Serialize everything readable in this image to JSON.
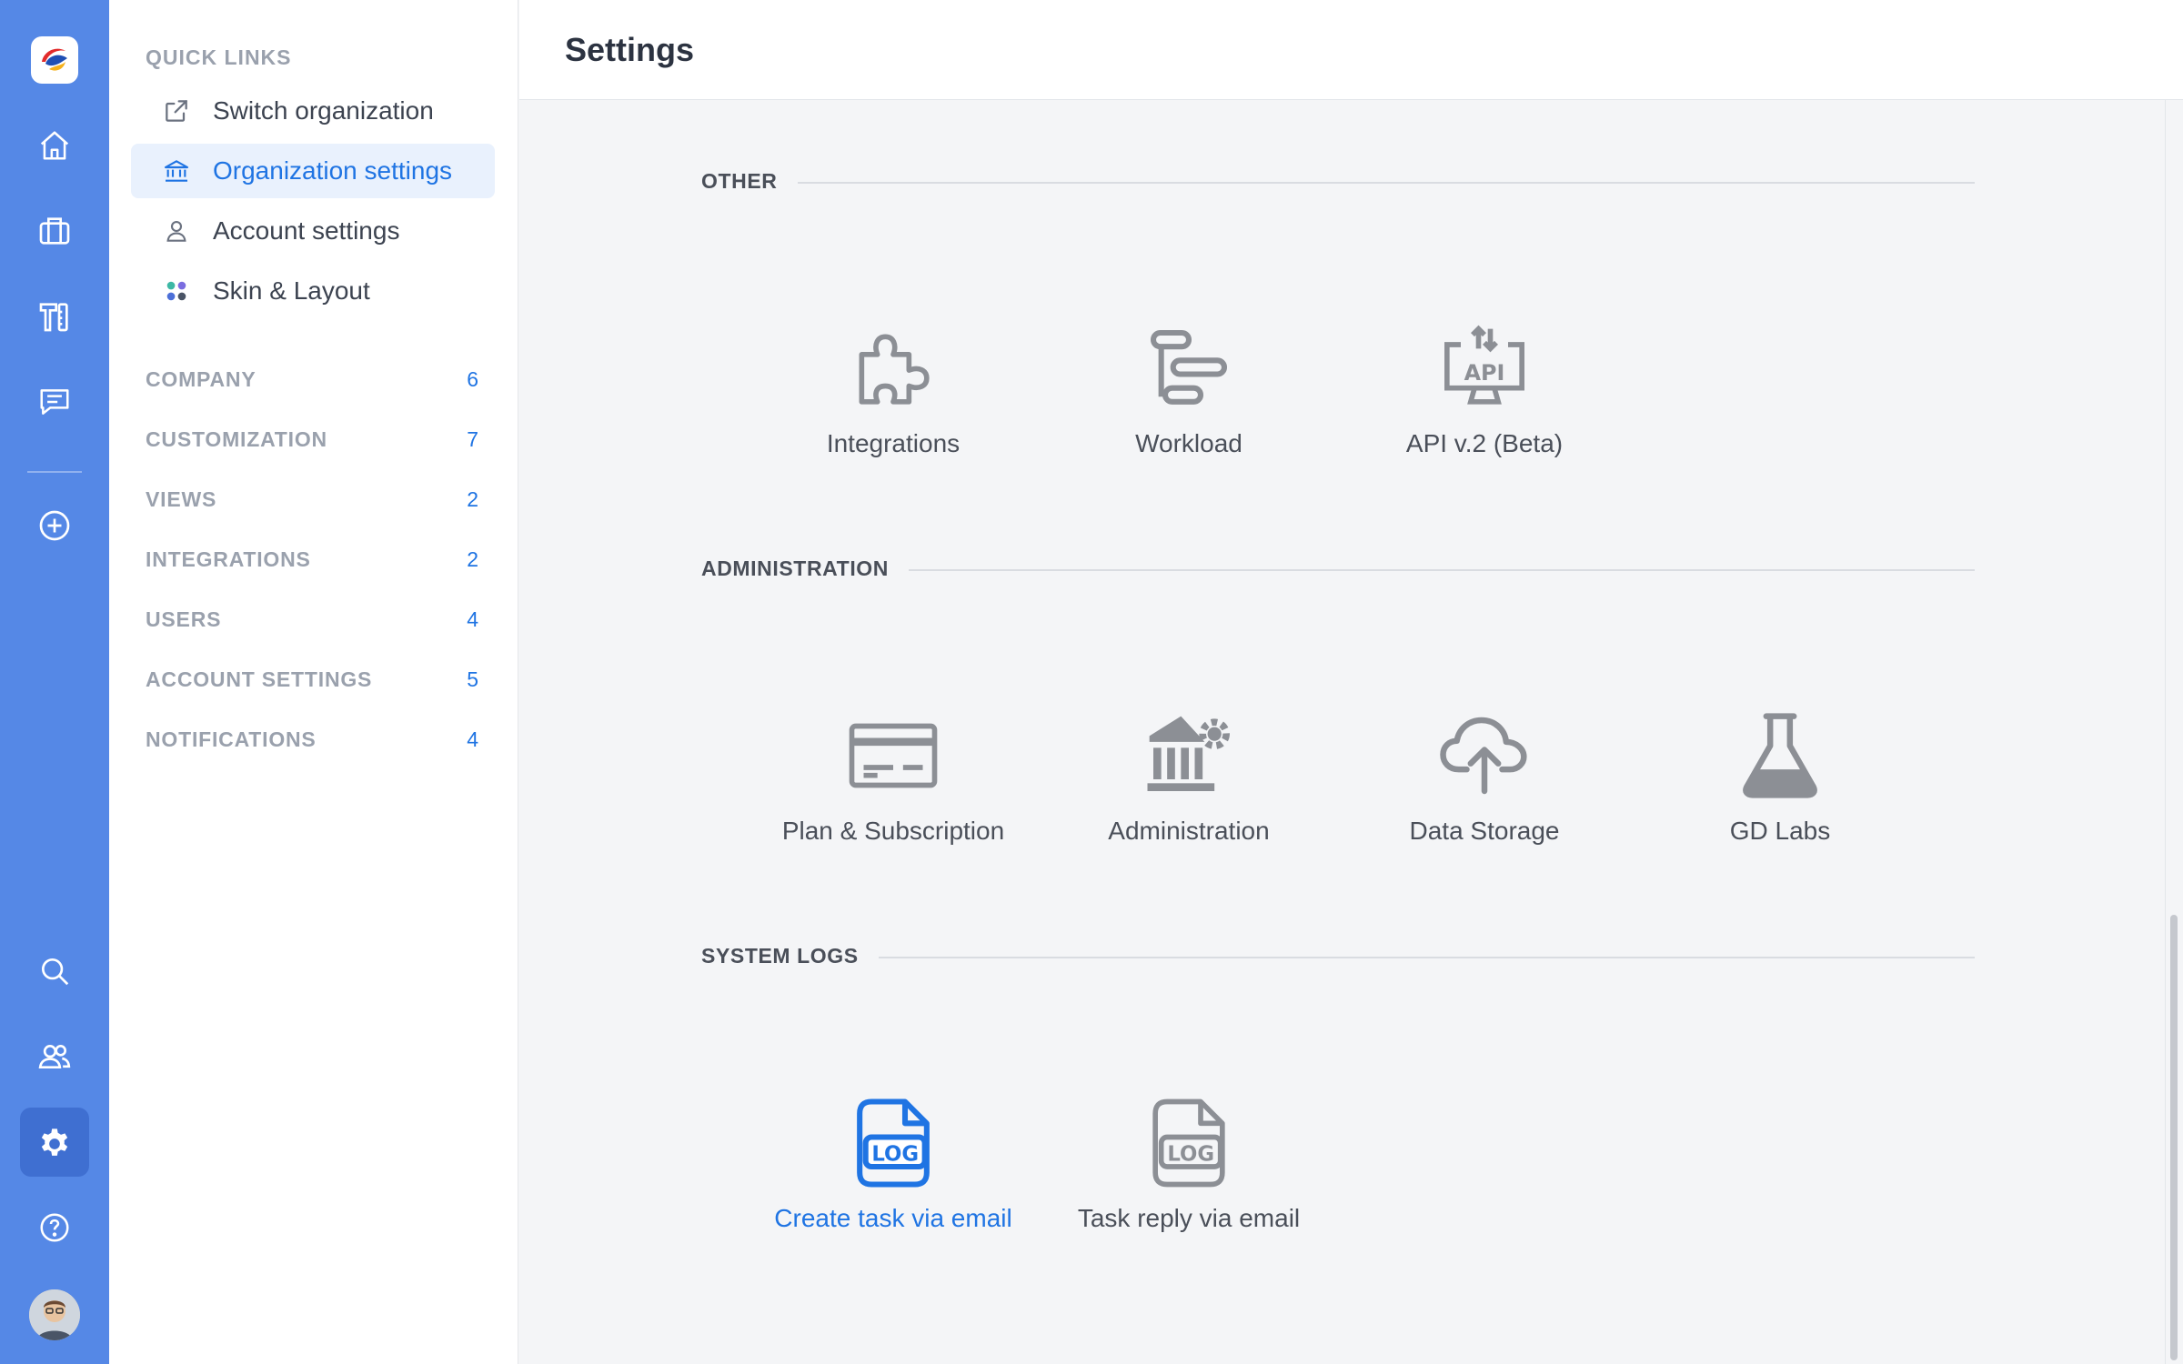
{
  "header": {
    "title": "Settings"
  },
  "rail": {
    "icons": [
      "home-icon",
      "briefcase-icon",
      "tools-icon",
      "chat-icon",
      "add-circle-icon",
      "search-icon",
      "users-icon",
      "gear-icon",
      "help-icon"
    ],
    "accent": "#5588e6",
    "active_bg": "#3f6fd1"
  },
  "sidebar": {
    "quick_links_title": "QUICK LINKS",
    "quick_links": [
      {
        "label": "Switch organization",
        "icon": "external-link-icon"
      },
      {
        "label": "Organization settings",
        "icon": "bank-icon"
      },
      {
        "label": "Account settings",
        "icon": "user-icon"
      },
      {
        "label": "Skin & Layout",
        "icon": "palette-dots-icon"
      }
    ],
    "categories": [
      {
        "label": "COMPANY",
        "count": "6"
      },
      {
        "label": "CUSTOMIZATION",
        "count": "7"
      },
      {
        "label": "VIEWS",
        "count": "2"
      },
      {
        "label": "INTEGRATIONS",
        "count": "2"
      },
      {
        "label": "USERS",
        "count": "4"
      },
      {
        "label": "ACCOUNT SETTINGS",
        "count": "5"
      },
      {
        "label": "NOTIFICATIONS",
        "count": "4"
      }
    ],
    "active_color": "#1f74e3"
  },
  "sections": {
    "other": {
      "title": "OTHER",
      "items": [
        {
          "label": "Integrations",
          "icon": "puzzle-icon"
        },
        {
          "label": "Workload",
          "icon": "workload-bars-icon"
        },
        {
          "label": "API v.2 (Beta)",
          "icon": "api-monitor-icon"
        }
      ]
    },
    "administration": {
      "title": "ADMINISTRATION",
      "items": [
        {
          "label": "Plan & Subscription",
          "icon": "credit-card-icon"
        },
        {
          "label": "Administration",
          "icon": "building-gear-icon"
        },
        {
          "label": "Data Storage",
          "icon": "cloud-upload-icon"
        },
        {
          "label": "GD Labs",
          "icon": "flask-icon"
        }
      ]
    },
    "system_logs": {
      "title": "SYSTEM LOGS",
      "items": [
        {
          "label": "Create task via email",
          "icon": "log-file-icon"
        },
        {
          "label": "Task reply via email",
          "icon": "log-file-icon"
        }
      ]
    }
  }
}
